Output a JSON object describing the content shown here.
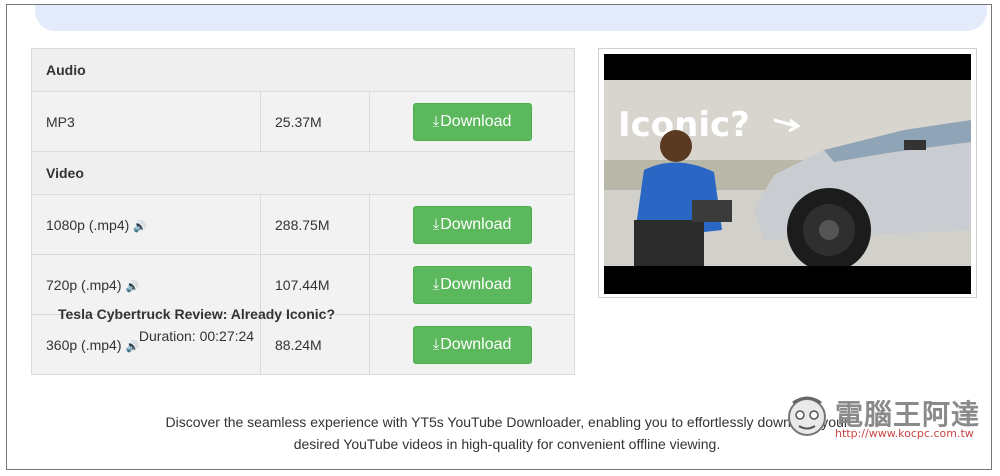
{
  "table": {
    "sections": {
      "audio": "Audio",
      "video": "Video"
    },
    "rows": [
      {
        "format": "MP3",
        "size": "25.37M",
        "button": "Download"
      },
      {
        "format": "1080p (.mp4)",
        "size": "288.75M",
        "button": "Download"
      },
      {
        "format": "720p (.mp4)",
        "size": "107.44M",
        "button": "Download"
      },
      {
        "format": "360p (.mp4)",
        "size": "88.24M",
        "button": "Download"
      }
    ]
  },
  "video": {
    "thumbnail_text": "Iconic?",
    "title": "Tesla Cybertruck Review: Already Iconic?",
    "duration": "Duration: 00:27:24"
  },
  "description": {
    "line1": "Discover the seamless experience with YT5s YouTube Downloader, enabling you to effortlessly download your",
    "line2": "desired YouTube videos in high-quality for convenient offline viewing."
  },
  "watermark": {
    "text": "電腦王阿達",
    "url": "http://www.kocpc.com.tw"
  },
  "icons": {
    "download": "download-icon",
    "speaker": "speaker-icon"
  },
  "colors": {
    "button": "#5cb85c",
    "top_bar": "#e4ebfb"
  }
}
